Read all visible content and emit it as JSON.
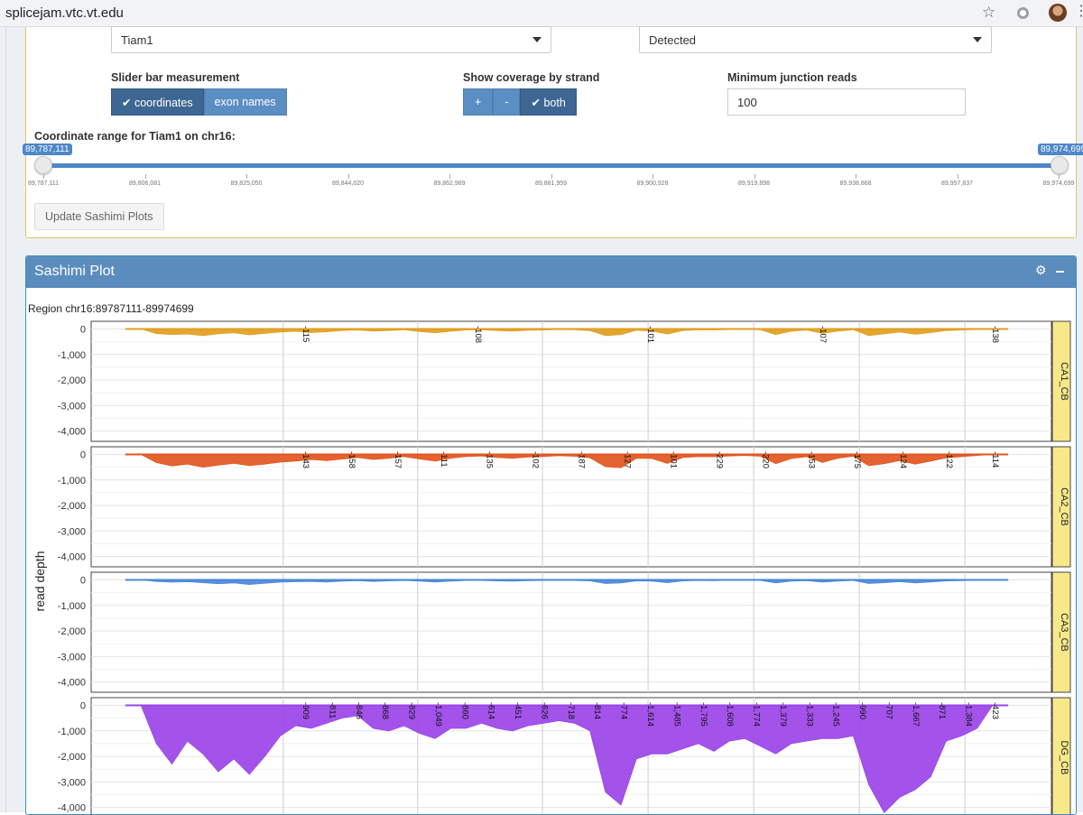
{
  "browser": {
    "url": "splicejam.vtc.vt.edu"
  },
  "controls": {
    "gene_select": "Tiam1",
    "detected_select": "Detected",
    "slider_measure_label": "Slider bar measurement",
    "measure_buttons": [
      "coordinates",
      "exon names"
    ],
    "measure_selected": "coordinates",
    "strand_label": "Show coverage by strand",
    "strand_buttons": [
      "+",
      "-",
      "both"
    ],
    "strand_selected": "both",
    "min_reads_label": "Minimum junction reads",
    "min_reads_value": "100",
    "range_title": "Coordinate range for Tiam1 on chr16:",
    "range_min": "89,787,111",
    "range_max": "89,974,699",
    "range_ticks": [
      "89,787,111",
      "89,806,081",
      "89,825,050",
      "89,844,020",
      "89,862,989",
      "89,881,959",
      "89,900,928",
      "89,919,898",
      "89,938,868",
      "89,957,837",
      "89,974,699"
    ],
    "update_button": "Update Sashimi Plots"
  },
  "sashimi": {
    "title": "Sashimi Plot",
    "region": "Region chr16:89787111-89974699"
  },
  "chart_data": {
    "type": "area",
    "ylabel": "read depth",
    "y_ticks": [
      "0",
      "-1,000",
      "-2,000",
      "-3,000",
      "-4,000"
    ],
    "ylim": [
      -4400,
      300
    ],
    "grid": true,
    "panels": [
      {
        "name": "CA1_CB",
        "color": "#e0a020",
        "junction_labels": [
          "-115",
          "-108",
          "-101",
          "-107",
          "-138"
        ],
        "coverage": [
          0,
          0,
          -180,
          -220,
          -200,
          -260,
          -190,
          -150,
          -230,
          -170,
          -120,
          -90,
          -140,
          -110,
          -60,
          -40,
          -80,
          -60,
          -30,
          -100,
          -150,
          -90,
          -40,
          -30,
          -60,
          -80,
          -50,
          -40,
          -20,
          -30,
          -60,
          -260,
          -220,
          -50,
          -80,
          -200,
          -60,
          -30,
          -40,
          -20,
          -10,
          -30,
          -220,
          -90,
          -40,
          -170,
          -80,
          -30,
          -260,
          -190,
          -120,
          -210,
          -140,
          -60,
          -40,
          -20,
          0,
          0
        ]
      },
      {
        "name": "CA2_CB",
        "color": "#e2561e",
        "junction_labels": [
          "-143",
          "-158",
          "-157",
          "-111",
          "-135",
          "-102",
          "-187",
          "-127",
          "-101",
          "-229",
          "-220",
          "-153",
          "-175",
          "-124",
          "-122",
          "-114"
        ],
        "coverage": [
          0,
          0,
          -320,
          -450,
          -380,
          -500,
          -420,
          -350,
          -440,
          -380,
          -300,
          -260,
          -200,
          -240,
          -180,
          -120,
          -200,
          -150,
          -80,
          -180,
          -260,
          -150,
          -80,
          -60,
          -120,
          -150,
          -100,
          -80,
          -50,
          -70,
          -130,
          -480,
          -520,
          -150,
          -160,
          -350,
          -120,
          -80,
          -90,
          -60,
          -40,
          -70,
          -360,
          -160,
          -90,
          -310,
          -150,
          -70,
          -440,
          -360,
          -240,
          -380,
          -260,
          -130,
          -90,
          -40,
          0,
          0
        ]
      },
      {
        "name": "CA3_CB",
        "color": "#4a88d8",
        "junction_labels": [],
        "coverage": [
          0,
          0,
          -60,
          -90,
          -70,
          -110,
          -150,
          -120,
          -180,
          -130,
          -90,
          -70,
          -60,
          -80,
          -50,
          -30,
          -60,
          -40,
          -20,
          -50,
          -80,
          -50,
          -20,
          -20,
          -40,
          -50,
          -30,
          -20,
          -10,
          -20,
          -40,
          -140,
          -120,
          -40,
          -50,
          -110,
          -40,
          -20,
          -30,
          -10,
          -10,
          -20,
          -120,
          -50,
          -30,
          -90,
          -50,
          -20,
          -140,
          -110,
          -70,
          -120,
          -80,
          -40,
          -30,
          -10,
          0,
          0
        ]
      },
      {
        "name": "DG_CB",
        "color": "#9b44e8",
        "junction_labels": [
          "-909",
          "-811",
          "-846",
          "-868",
          "-829",
          "-1,049",
          "-860",
          "-614",
          "-451",
          "-626",
          "-718",
          "-814",
          "-774",
          "-1,614",
          "-1,485",
          "-1,795",
          "-1,608",
          "-1,774",
          "-1,379",
          "-1,333",
          "-1,245",
          "-990",
          "-707",
          "-1,667",
          "-871",
          "-1,384",
          "-423"
        ],
        "coverage": [
          0,
          0,
          -1500,
          -2300,
          -1400,
          -1900,
          -2600,
          -2100,
          -2700,
          -2000,
          -1200,
          -800,
          -900,
          -700,
          -500,
          -400,
          -900,
          -1000,
          -800,
          -1100,
          -1300,
          -900,
          -900,
          -700,
          -900,
          -1000,
          -800,
          -700,
          -600,
          -700,
          -1000,
          -3400,
          -3900,
          -2100,
          -1900,
          -1900,
          -1700,
          -1500,
          -1800,
          -1400,
          -1300,
          -1600,
          -1900,
          -1500,
          -1400,
          -1300,
          -1300,
          -1200,
          -3100,
          -4200,
          -3600,
          -3300,
          -2800,
          -1400,
          -1200,
          -900,
          0,
          0
        ]
      }
    ]
  }
}
